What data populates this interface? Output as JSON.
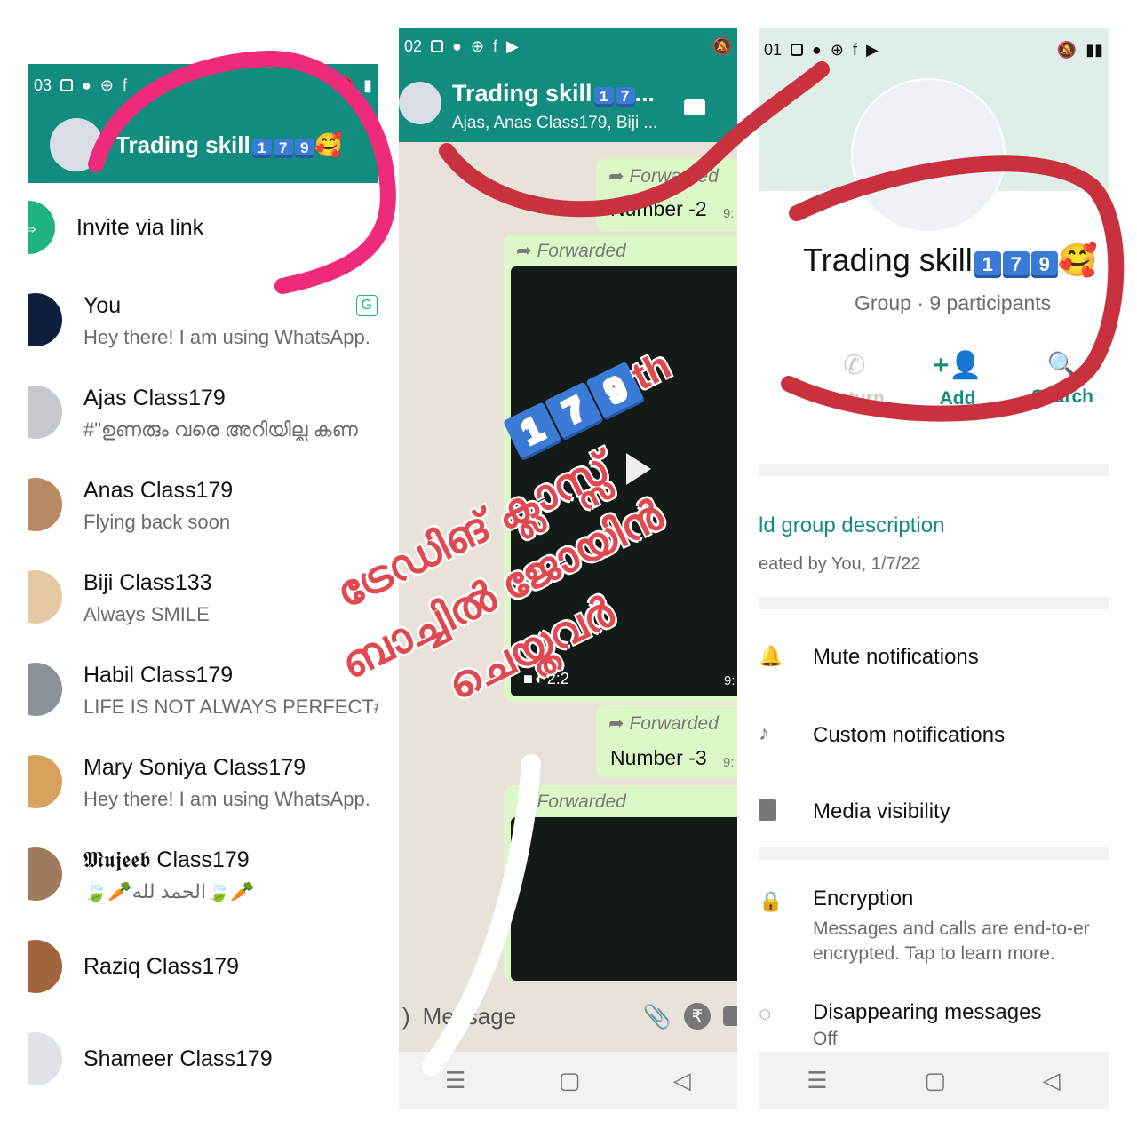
{
  "panel_left": {
    "status": {
      "time": "03"
    },
    "header": {
      "title": "Trading skill",
      "digits": [
        "1",
        "7",
        "9"
      ],
      "emoji": "🥰"
    },
    "invite": {
      "label": "Invite via link"
    },
    "members": [
      {
        "name": "You",
        "status": "Hey there! I am using WhatsApp.",
        "badge": "G"
      },
      {
        "name": "Ajas Class179",
        "status": "#\"ഉണരും വരെ അറിയില്ല കണ"
      },
      {
        "name": "Anas Class179",
        "status": "Flying back soon"
      },
      {
        "name": "Biji Class133",
        "status": "Always SMILE"
      },
      {
        "name": "Habil Class179",
        "status": "LIFE IS NOT ALWAYS PERFECT#"
      },
      {
        "name": "Mary Soniya Class179",
        "status": "Hey there! I am using WhatsApp."
      },
      {
        "name": "𝕸𝖚𝖏𝖊𝖊𝖇 Class179",
        "status": "🍃🥕الحمد لله🍃🥕"
      },
      {
        "name": "Raziq Class179",
        "status": ""
      },
      {
        "name": "Shameer Class179",
        "status": ""
      }
    ]
  },
  "panel_middle": {
    "status": {
      "time": "02"
    },
    "header": {
      "title": "Trading skill",
      "digits": [
        "1",
        "7"
      ],
      "ellipsis": "...",
      "subtitle": "Ajas, Anas Class179, Biji ..."
    },
    "messages": [
      {
        "forwarded": "Forwarded",
        "text": "Number -2",
        "time": "9:"
      },
      {
        "forwarded": "Forwarded",
        "video_duration": "2:2",
        "time": "9:"
      },
      {
        "forwarded": "Forwarded",
        "text": "Number -3",
        "time": "9:"
      },
      {
        "forwarded": "Forwarded"
      }
    ],
    "composer": {
      "placeholder": "Message"
    }
  },
  "panel_right": {
    "status": {
      "time": "01"
    },
    "group": {
      "title": "Trading skill",
      "digits": [
        "1",
        "7",
        "9"
      ],
      "emoji": "🥰",
      "subtitle": "Group · 9 participants"
    },
    "actions": {
      "call": "Return",
      "add": "Add",
      "search": "Search"
    },
    "description": {
      "add": "ld group description",
      "created": "eated by You, 1/7/22"
    },
    "settings": [
      {
        "label": "Mute notifications"
      },
      {
        "label": "Custom notifications"
      },
      {
        "label": "Media visibility"
      },
      {
        "label": "Encryption",
        "value": "Messages and calls are end-to-er\nencrypted. Tap to learn more."
      },
      {
        "label": "Disappearing messages",
        "value": "Off"
      }
    ]
  },
  "overlay": {
    "digits": [
      "1",
      "7",
      "9"
    ],
    "suffix": "th",
    "lines": [
      "ട്രേഡിങ് ക്ലാസ്സ്",
      "ബാച്ചിൽ ജോയിൻ",
      "ചെയ്തവർ"
    ]
  },
  "colors": {
    "whatsapp_green": "#128c7e",
    "accent": "#1fb47f",
    "bubble": "#dcf8c6",
    "annotation_pink": "#ee2a7b",
    "annotation_red": "#c9313f",
    "overlay_text": "#e0494f"
  }
}
